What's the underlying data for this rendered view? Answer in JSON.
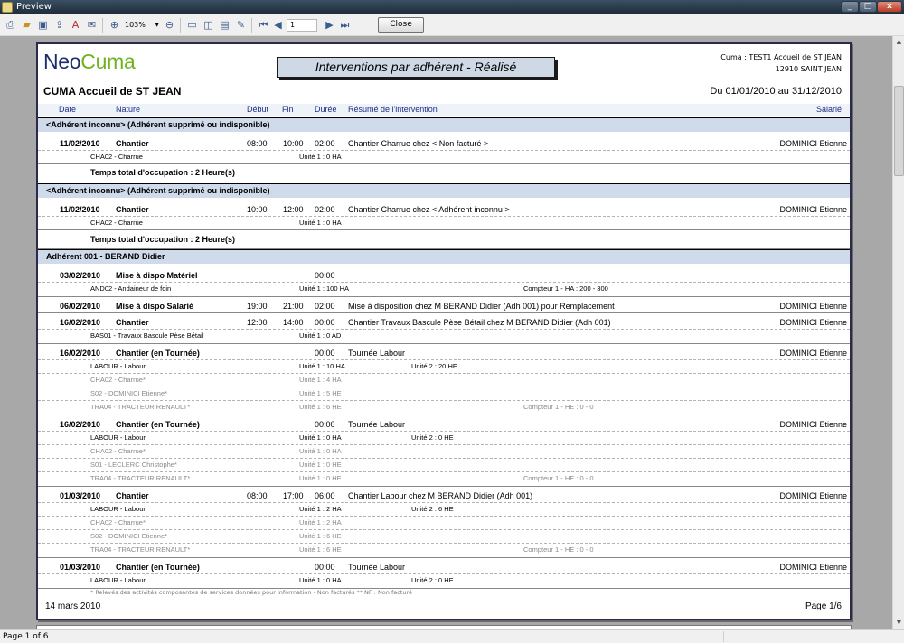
{
  "window": {
    "title": "Preview",
    "min": "_",
    "max": "□",
    "close": "x"
  },
  "toolbar": {
    "zoom": "103%",
    "page_value": "1",
    "close_label": "Close"
  },
  "status": {
    "page": "Page 1 of 6"
  },
  "report": {
    "logo_neo": "Neo",
    "logo_cuma": "Cuma",
    "title": "Interventions par adhérent - Réalisé",
    "address_line1": "Cuma : TEST1 Accueil de  ST JEAN",
    "address_line2": "12910  SAINT JEAN",
    "org": "CUMA Accueil de ST JEAN",
    "period": "Du 01/01/2010 au 31/12/2010",
    "columns": {
      "date": "Date",
      "nature": "Nature",
      "debut": "Début",
      "fin": "Fin",
      "duree": "Durée",
      "resume": "Résumé de l'intervention",
      "salarie": "Salarié"
    },
    "groups": [
      {
        "label": "<Adhérent inconnu> (Adhérent supprimé ou indisponible)",
        "entry": {
          "date": "11/02/2010",
          "nature": "Chantier",
          "debut": "08:00",
          "fin": "10:00",
          "duree": "02:00",
          "resume": "Chantier Charrue chez  < Non facturé >",
          "salarie": "DOMINICI Etienne",
          "sub": "CHA02 - Charrue",
          "unit": "Unité 1 : 0 HA"
        },
        "total": "Temps total d'occupation : 2 Heure(s)"
      },
      {
        "label": "<Adhérent inconnu> (Adhérent supprimé ou indisponible)",
        "entry": {
          "date": "11/02/2010",
          "nature": "Chantier",
          "debut": "10:00",
          "fin": "12:00",
          "duree": "02:00",
          "resume": "Chantier Charrue chez  < Adhérent inconnu >",
          "salarie": "DOMINICI Etienne",
          "sub": "CHA02 - Charrue",
          "unit": "Unité 1 : 0 HA"
        },
        "total": "Temps total d'occupation : 2 Heure(s)"
      },
      {
        "label": "Adhérent 001 - BERAND Didier"
      }
    ],
    "entries": [
      {
        "date": "03/02/2010",
        "nature": "Mise à dispo Matériel",
        "duree": "00:00",
        "subs": [
          {
            "name": "AND02 - Andaineur de foin",
            "u1": "Unité 1 : 100 HA",
            "compteur": "Compteur 1 - HA : 200 - 300"
          }
        ]
      },
      {
        "date": "06/02/2010",
        "nature": "Mise à dispo Salarié",
        "debut": "19:00",
        "fin": "21:00",
        "duree": "02:00",
        "resume": "Mise à disposition chez M BERAND Didier (Adh 001) pour Remplacement",
        "salarie": "DOMINICI Etienne"
      },
      {
        "date": "16/02/2010",
        "nature": "Chantier",
        "debut": "12:00",
        "fin": "14:00",
        "duree": "00:00",
        "resume": "Chantier Travaux Bascule Pèse Bétail chez M BERAND Didier (Adh 001)",
        "salarie": "DOMINICI Etienne",
        "subs": [
          {
            "name": "BAS01 - Travaux Bascule Pèse Bétail",
            "u1": "Unité 1 : 0 AD"
          }
        ]
      },
      {
        "date": "16/02/2010",
        "nature": "Chantier (en Tournée)",
        "duree": "00:00",
        "resume": "Tournée Labour",
        "salarie": "DOMINICI Etienne",
        "subs": [
          {
            "name": "LABOUR - Labour",
            "u1": "Unité 1 : 10 HA",
            "u2": "Unité 2 : 20 HE"
          },
          {
            "name": "CHA02 - Charrue*",
            "u1": "Unité 1 : 4 HA",
            "grey": true
          },
          {
            "name": "S02 - DOMINICI Etienne*",
            "u1": "Unité 1 : 5 HE",
            "grey": true
          },
          {
            "name": "TRA04 - TRACTEUR RENAULT*",
            "u1": "Unité 1 : 6 HE",
            "compteur": "Compteur 1 - HE : 0 - 0",
            "grey": true
          }
        ]
      },
      {
        "date": "16/02/2010",
        "nature": "Chantier (en Tournée)",
        "duree": "00:00",
        "resume": "Tournée Labour",
        "salarie": "DOMINICI Etienne",
        "subs": [
          {
            "name": "LABOUR - Labour",
            "u1": "Unité 1 : 0 HA",
            "u2": "Unité 2 : 0 HE"
          },
          {
            "name": "CHA02 - Charrue*",
            "u1": "Unité 1 : 0 HA",
            "grey": true
          },
          {
            "name": "S01 - LECLERC Christophe*",
            "u1": "Unité 1 : 0 HE",
            "grey": true
          },
          {
            "name": "TRA04 - TRACTEUR RENAULT*",
            "u1": "Unité 1 : 0 HE",
            "compteur": "Compteur 1 - HE : 0 - 0",
            "grey": true
          }
        ]
      },
      {
        "date": "01/03/2010",
        "nature": "Chantier",
        "debut": "08:00",
        "fin": "17:00",
        "duree": "06:00",
        "resume": "Chantier Labour chez M BERAND Didier (Adh 001)",
        "salarie": "DOMINICI Etienne",
        "subs": [
          {
            "name": "LABOUR - Labour",
            "u1": "Unité 1 : 2 HA",
            "u2": "Unité 2 : 6 HE"
          },
          {
            "name": "CHA02 - Charrue*",
            "u1": "Unité 1 : 2 HA",
            "grey": true
          },
          {
            "name": "S02 - DOMINICI Etienne*",
            "u1": "Unité 1 : 6 HE",
            "grey": true
          },
          {
            "name": "TRA04 - TRACTEUR RENAULT*",
            "u1": "Unité 1 : 6 HE",
            "compteur": "Compteur 1 - HE : 0 - 0",
            "grey": true
          }
        ]
      },
      {
        "date": "01/03/2010",
        "nature": "Chantier (en Tournée)",
        "duree": "00:00",
        "resume": "Tournée Labour",
        "salarie": "DOMINICI Etienne",
        "subs": [
          {
            "name": "LABOUR - Labour",
            "u1": "Unité 1 : 0 HA",
            "u2": "Unité 2 : 0 HE"
          }
        ]
      }
    ],
    "footnote": "* Relevés des activités composantes de services données pour information - Non facturés      ** NF : Non facturé",
    "print_date": "14 mars 2010",
    "page": "Page 1/6"
  }
}
